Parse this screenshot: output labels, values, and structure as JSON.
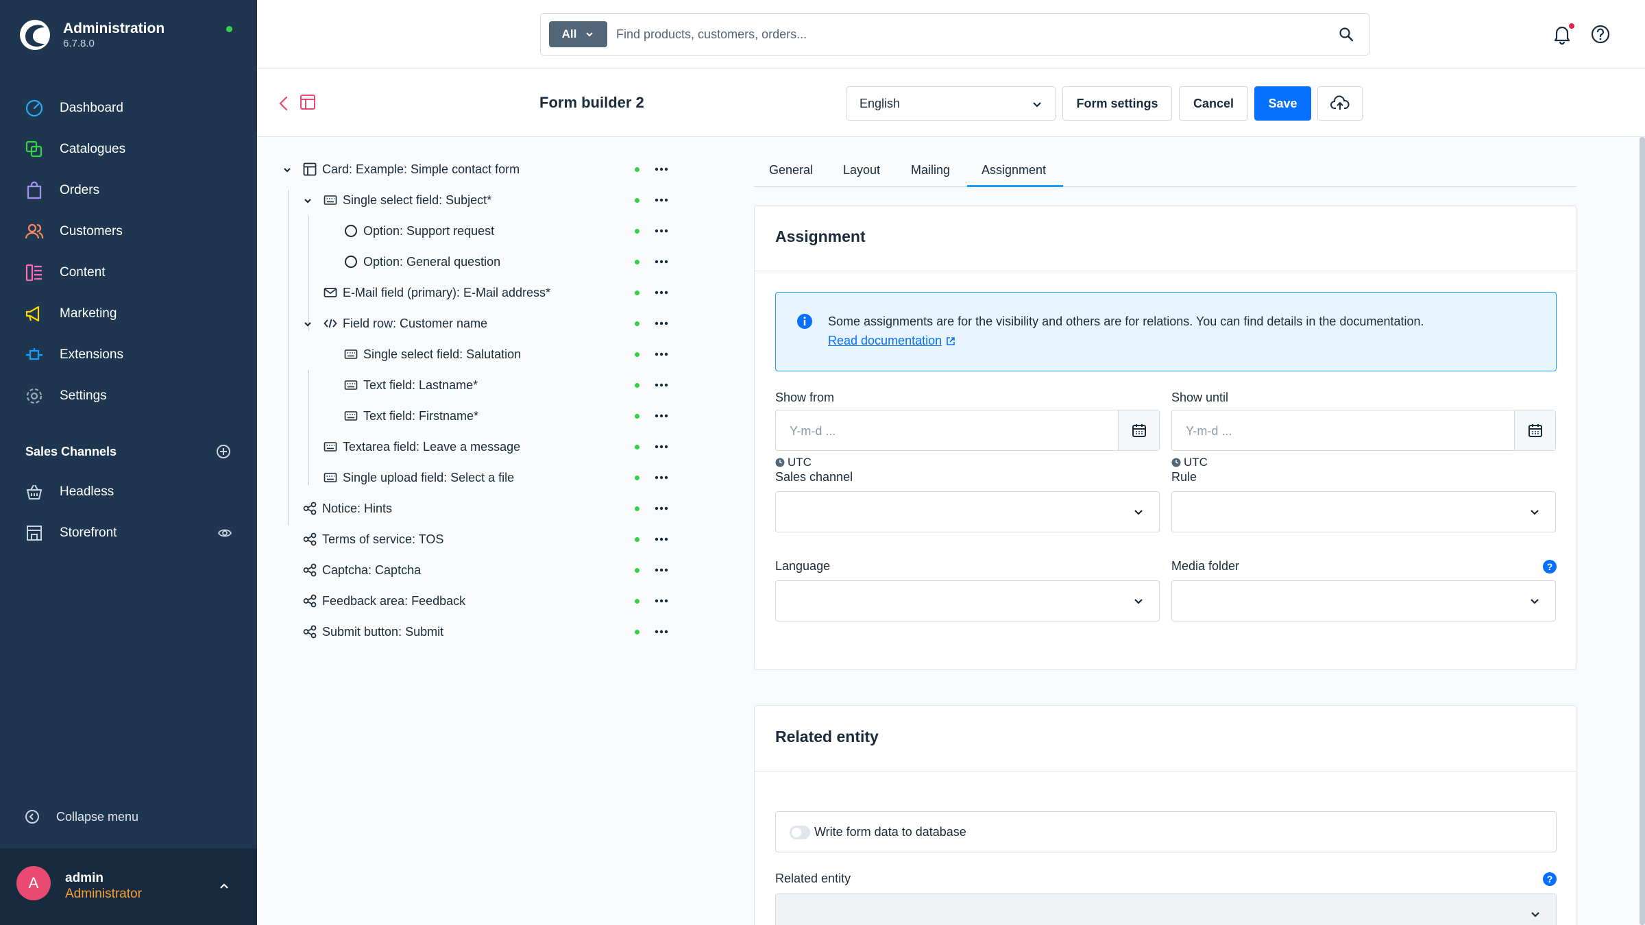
{
  "app": {
    "title": "Administration",
    "version": "6.7.8.0"
  },
  "sidebar": {
    "items": [
      {
        "label": "Dashboard",
        "icon": "dashboard-icon"
      },
      {
        "label": "Catalogues",
        "icon": "catalogues-icon"
      },
      {
        "label": "Orders",
        "icon": "orders-icon"
      },
      {
        "label": "Customers",
        "icon": "customers-icon"
      },
      {
        "label": "Content",
        "icon": "content-icon"
      },
      {
        "label": "Marketing",
        "icon": "marketing-icon"
      },
      {
        "label": "Extensions",
        "icon": "extensions-icon"
      },
      {
        "label": "Settings",
        "icon": "settings-icon"
      }
    ],
    "sales_channels_title": "Sales Channels",
    "sales_channels": [
      {
        "label": "Headless",
        "icon": "basket-icon"
      },
      {
        "label": "Storefront",
        "icon": "storefront-icon"
      }
    ],
    "collapse_label": "Collapse menu",
    "user": {
      "initial": "A",
      "name": "admin",
      "role": "Administrator"
    }
  },
  "topbar": {
    "search_type": "All",
    "search_placeholder": "Find products, customers, orders..."
  },
  "header": {
    "title": "Form builder 2",
    "language": "English",
    "form_settings_label": "Form settings",
    "cancel_label": "Cancel",
    "save_label": "Save"
  },
  "tree": [
    {
      "label": "Card: Example: Simple contact form",
      "level": 0,
      "icon": "card-icon",
      "expandable": true
    },
    {
      "label": "Single select field: Subject*",
      "level": 1,
      "icon": "keyboard-icon",
      "expandable": true
    },
    {
      "label": "Option: Support request",
      "level": 2,
      "icon": "radio-icon",
      "expandable": false
    },
    {
      "label": "Option: General question",
      "level": 2,
      "icon": "radio-icon",
      "expandable": false
    },
    {
      "label": "E-Mail field (primary): E-Mail address*",
      "level": 1,
      "icon": "mail-icon",
      "expandable": false
    },
    {
      "label": "Field row: Customer name",
      "level": 1,
      "icon": "code-icon",
      "expandable": true
    },
    {
      "label": "Single select field: Salutation",
      "level": 2,
      "icon": "keyboard-icon",
      "expandable": false
    },
    {
      "label": "Text field: Lastname*",
      "level": 2,
      "icon": "keyboard-icon",
      "expandable": false
    },
    {
      "label": "Text field: Firstname*",
      "level": 2,
      "icon": "keyboard-icon",
      "expandable": false
    },
    {
      "label": "Textarea field: Leave a message",
      "level": 1,
      "icon": "keyboard-icon",
      "expandable": false
    },
    {
      "label": "Single upload field: Select a file",
      "level": 1,
      "icon": "keyboard-icon",
      "expandable": false
    },
    {
      "label": "Notice: Hints",
      "level": 0,
      "icon": "share-icon",
      "expandable": false
    },
    {
      "label": "Terms of service: TOS",
      "level": 0,
      "icon": "share-icon",
      "expandable": false
    },
    {
      "label": "Captcha: Captcha",
      "level": 0,
      "icon": "share-icon",
      "expandable": false
    },
    {
      "label": "Feedback area: Feedback",
      "level": 0,
      "icon": "share-icon",
      "expandable": false
    },
    {
      "label": "Submit button: Submit",
      "level": 0,
      "icon": "share-icon",
      "expandable": false
    }
  ],
  "tabs": [
    "General",
    "Layout",
    "Mailing",
    "Assignment"
  ],
  "active_tab": "Assignment",
  "assignment": {
    "title": "Assignment",
    "info_text": "Some assignments are for the visibility and others are for relations. You can find details in the documentation.",
    "info_link": "Read documentation",
    "show_from_label": "Show from",
    "show_until_label": "Show until",
    "date_placeholder": "Y-m-d ...",
    "timezone": "UTC",
    "sales_channel_label": "Sales channel",
    "rule_label": "Rule",
    "language_label": "Language",
    "media_folder_label": "Media folder"
  },
  "related": {
    "title": "Related entity",
    "toggle_label": "Write form data to database",
    "related_entity_label": "Related entity"
  },
  "colors": {
    "sidebar": "#1f3650",
    "primary": "#0870ff",
    "status": "#37d046",
    "accent": "#189eff"
  }
}
